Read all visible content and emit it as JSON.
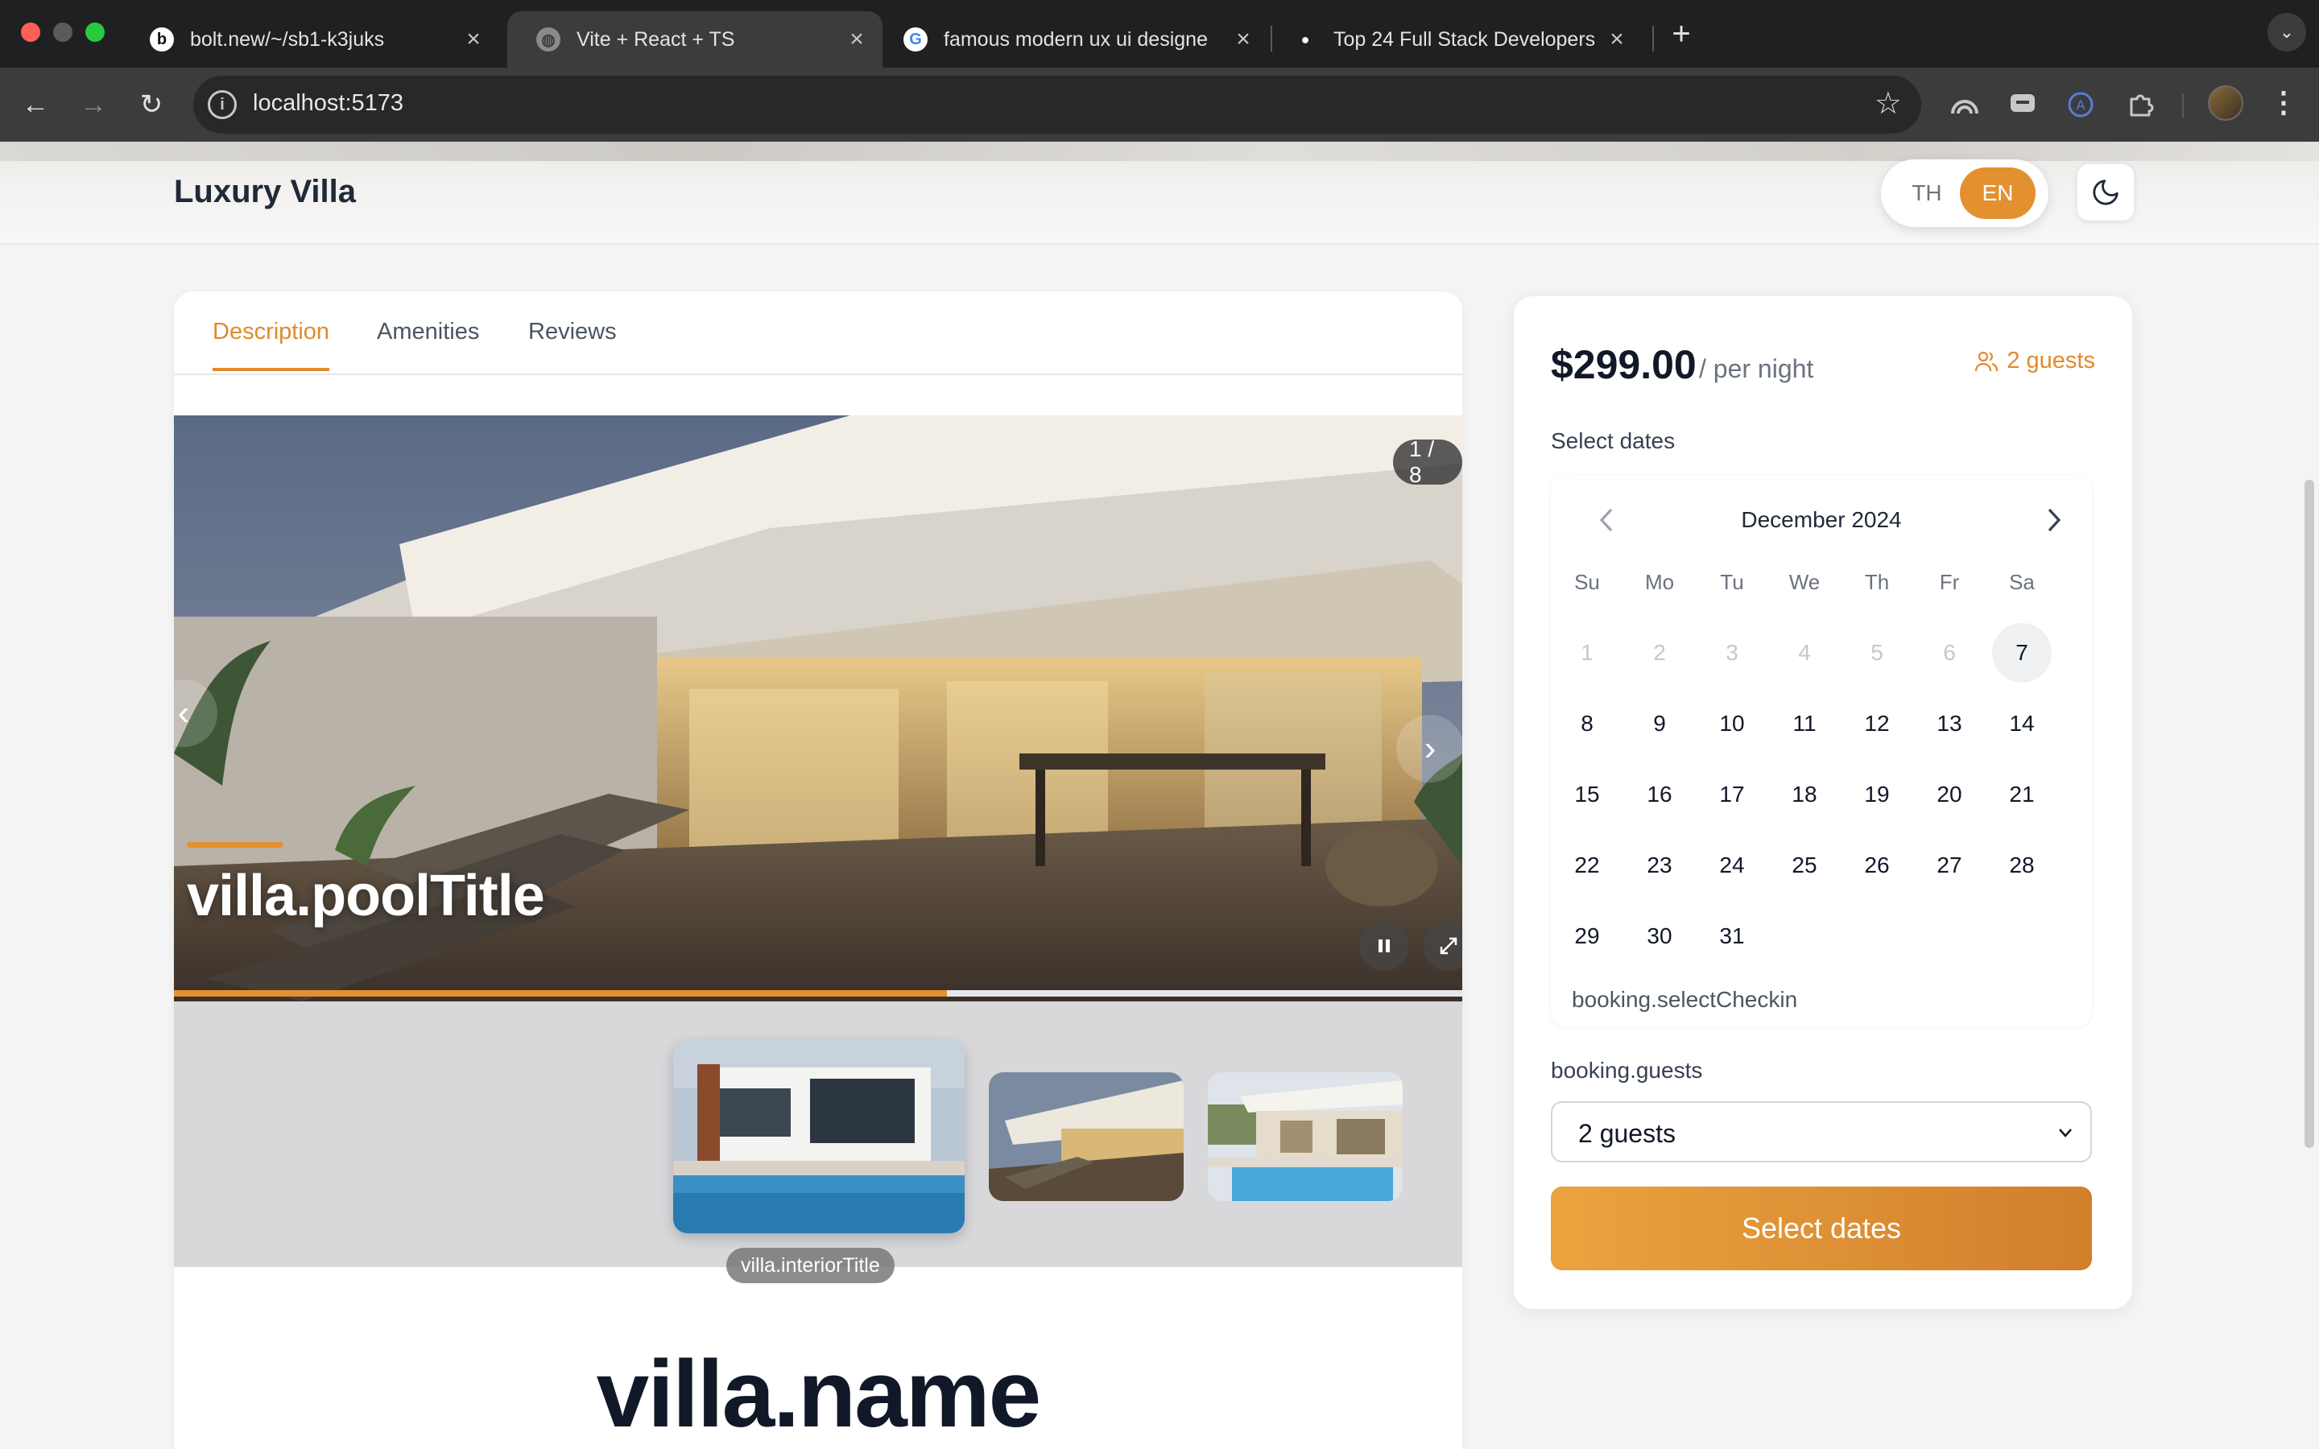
{
  "browser": {
    "tabs": [
      {
        "title": "bolt.new/~/sb1-k3juks",
        "favicon": "b"
      },
      {
        "title": "Vite + React + TS",
        "favicon": "globe"
      },
      {
        "title": "famous modern ux ui designe",
        "favicon": "G"
      },
      {
        "title": "Top 24 Full Stack Developers",
        "favicon": "dot"
      }
    ],
    "url": "localhost:5173",
    "icons": [
      "back-arrow-icon",
      "forward-arrow-icon",
      "reload-icon",
      "site-info-icon",
      "bookmark-star-icon",
      "extension-icon",
      "profile-avatar",
      "kebab-menu-icon"
    ]
  },
  "header": {
    "brand": "Luxury Villa",
    "lang": {
      "th": "TH",
      "en": "EN",
      "active": "EN"
    }
  },
  "tabs": [
    "Description",
    "Amenities",
    "Reviews"
  ],
  "gallery": {
    "counter": "1 / 8",
    "slide_title": "villa.poolTitle",
    "thumb_caption": "villa.interiorTitle",
    "progress": 0.6
  },
  "villa": {
    "name": "villa.name"
  },
  "booking": {
    "price": "$299.00",
    "per_night": "/ per night",
    "guests_badge": "2 guests",
    "select_dates_label": "Select dates",
    "month": "December 2024",
    "dow": [
      "Su",
      "Mo",
      "Tu",
      "We",
      "Th",
      "Fr",
      "Sa"
    ],
    "hint": "booking.selectCheckin",
    "guests_label": "booking.guests",
    "guests_value": "2 guests",
    "button": "Select dates"
  },
  "colors": {
    "accent": "#e39130",
    "accent_text": "#e08a2c"
  }
}
